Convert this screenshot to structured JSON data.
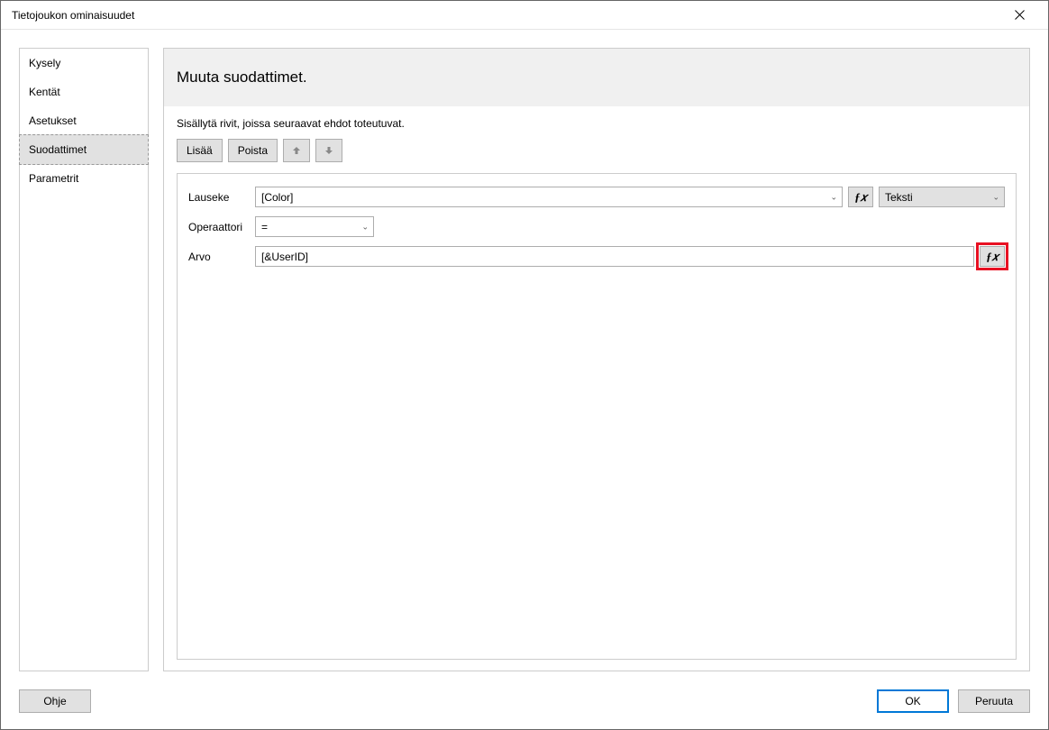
{
  "window": {
    "title": "Tietojoukon ominaisuudet"
  },
  "sidebar": {
    "items": [
      {
        "label": "Kysely",
        "selected": false
      },
      {
        "label": "Kentät",
        "selected": false
      },
      {
        "label": "Asetukset",
        "selected": false
      },
      {
        "label": "Suodattimet",
        "selected": true
      },
      {
        "label": "Parametrit",
        "selected": false
      }
    ]
  },
  "main": {
    "heading": "Muuta suodattimet.",
    "instruction": "Sisällytä rivit, joissa seuraavat ehdot toteutuvat.",
    "toolbar": {
      "add": "Lisää",
      "remove": "Poista"
    },
    "filter": {
      "expression_label": "Lauseke",
      "expression_value": "[Color]",
      "type_value": "Teksti",
      "operator_label": "Operaattori",
      "operator_value": "=",
      "value_label": "Arvo",
      "value_value": "[&UserID]"
    }
  },
  "footer": {
    "help": "Ohje",
    "ok": "OK",
    "cancel": "Peruuta"
  }
}
